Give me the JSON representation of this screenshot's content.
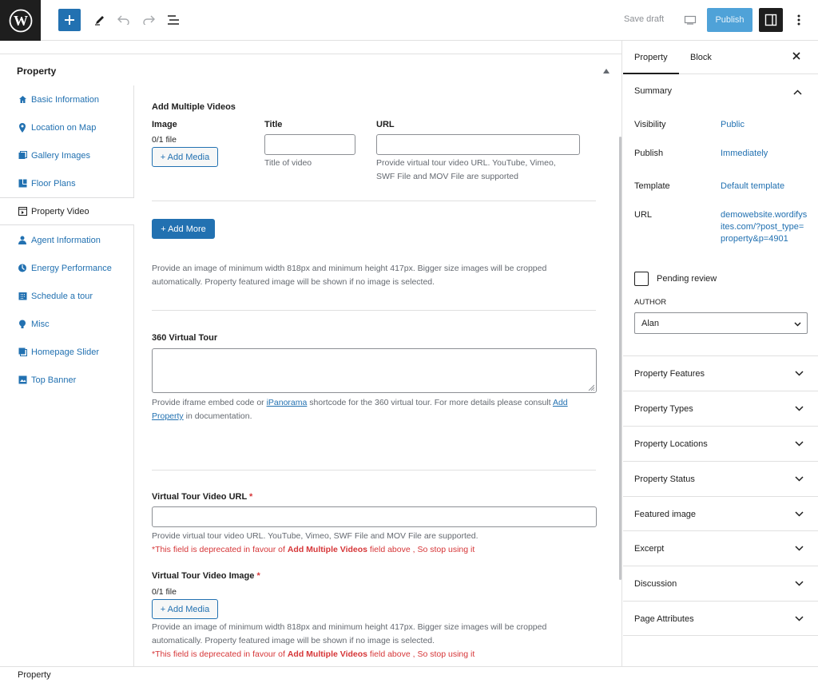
{
  "topbar": {
    "save_draft": "Save draft",
    "publish": "Publish"
  },
  "metabox": {
    "title": "Property"
  },
  "tabs": [
    {
      "label": "Basic Information",
      "icon": "home-icon"
    },
    {
      "label": "Location on Map",
      "icon": "pin-icon"
    },
    {
      "label": "Gallery Images",
      "icon": "gallery-icon"
    },
    {
      "label": "Floor Plans",
      "icon": "floorplan-icon"
    },
    {
      "label": "Property Video",
      "icon": "video-icon"
    },
    {
      "label": "Agent Information",
      "icon": "agent-icon"
    },
    {
      "label": "Energy Performance",
      "icon": "energy-icon"
    },
    {
      "label": "Schedule a tour",
      "icon": "calendar-icon"
    },
    {
      "label": "Misc",
      "icon": "bulb-icon"
    },
    {
      "label": "Homepage Slider",
      "icon": "slider-icon"
    },
    {
      "label": "Top Banner",
      "icon": "banner-icon"
    }
  ],
  "videos": {
    "heading": "Add Multiple Videos",
    "col_image": "Image",
    "col_title": "Title",
    "col_url": "URL",
    "file_count": "0/1 file",
    "add_media": "+ Add Media",
    "title_hint": "Title of video",
    "url_hint_1": "Provide virtual tour video URL. YouTube, Vimeo,",
    "url_hint_2": "SWF File and MOV File are supported",
    "add_more": "+ Add More",
    "image_note_1": "Provide an image of minimum width 818px and minimum height 417px. Bigger size images will be cropped",
    "image_note_2": "automatically. Property featured image will be shown if no image is selected."
  },
  "tour360": {
    "label": "360 Virtual Tour",
    "desc_1": "Provide iframe embed code or ",
    "desc_link_1": "iPanorama",
    "desc_2": " shortcode for the 360 virtual tour. For more details please consult ",
    "desc_link_2a": "Add",
    "desc_link_2b": "Property",
    "desc_3": " in documentation."
  },
  "video_url": {
    "label": "Virtual Tour Video URL",
    "required": "*",
    "desc": "Provide virtual tour video URL. YouTube, Vimeo, SWF File and MOV File are supported.",
    "warn_1": "*This field is deprecated in favour of ",
    "warn_bold": "Add Multiple Videos",
    "warn_2": " field above , So stop using it"
  },
  "video_image": {
    "label": "Virtual Tour Video Image",
    "required": "*",
    "file_count": "0/1 file",
    "add_media": "+ Add Media",
    "note_1": "Provide an image of minimum width 818px and minimum height 417px. Bigger size images will be cropped",
    "note_2": "automatically. Property featured image will be shown if no image is selected.",
    "warn_1": "*This field is deprecated in favour of ",
    "warn_bold": "Add Multiple Videos",
    "warn_2": " field above , So stop using it"
  },
  "sidebar": {
    "tab_property": "Property",
    "tab_block": "Block",
    "summary": "Summary",
    "visibility_label": "Visibility",
    "visibility_value": "Public",
    "publish_label": "Publish",
    "publish_value": "Immediately",
    "template_label": "Template",
    "template_value": "Default template",
    "url_label": "URL",
    "url_value": "demowebsite.wordifysites.com/?post_type=property&p=4901",
    "pending_review": "Pending review",
    "author_label": "AUTHOR",
    "author_value": "Alan",
    "panels": [
      "Property Features",
      "Property Types",
      "Property Locations",
      "Property Status",
      "Featured image",
      "Excerpt",
      "Discussion",
      "Page Attributes"
    ]
  },
  "footer": {
    "breadcrumb": "Property"
  },
  "colors": {
    "accent": "#2271b1",
    "dark": "#1e1e1e",
    "warning": "#d63638"
  }
}
